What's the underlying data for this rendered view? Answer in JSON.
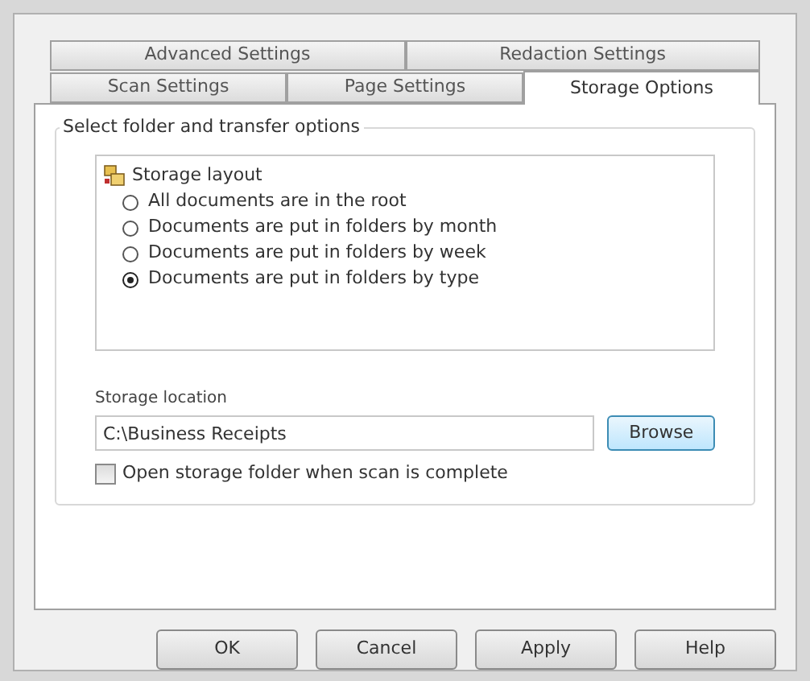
{
  "tab_rows": [
    [
      {
        "label": "Advanced Settings",
        "selected": false
      },
      {
        "label": "Redaction Settings",
        "selected": false
      }
    ],
    [
      {
        "label": "Scan Settings",
        "selected": false
      },
      {
        "label": "Page Settings",
        "selected": false
      },
      {
        "label": "Storage Options",
        "selected": true
      }
    ]
  ],
  "group": {
    "title": "Select folder and transfer options",
    "tree": {
      "label": "Storage layout",
      "options": [
        {
          "label": "All documents are in the root",
          "selected": false
        },
        {
          "label": "Documents are put in folders by month",
          "selected": false
        },
        {
          "label": "Documents are put in folders by week",
          "selected": false
        },
        {
          "label": "Documents are put in folders by type",
          "selected": true
        }
      ]
    },
    "location": {
      "label": "Storage location",
      "value": "C:\\Business Receipts",
      "button": "Browse"
    },
    "open_folder": {
      "label": "Open storage folder when scan is complete",
      "checked": false
    }
  },
  "buttons": [
    "OK",
    "Cancel",
    "Apply",
    "Help"
  ]
}
